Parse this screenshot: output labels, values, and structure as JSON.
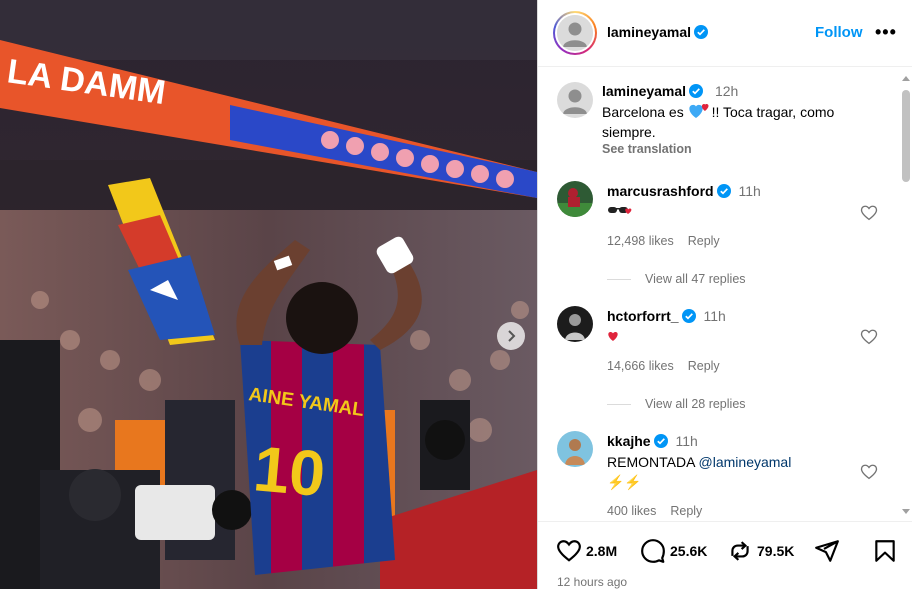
{
  "post": {
    "author": "lamineyamal",
    "follow_label": "Follow",
    "more_label": "•••",
    "caption_time": "12h",
    "caption_line1": "Barcelona es ",
    "caption_line1_end": "!! Toca tragar, como",
    "caption_line2": "siempre.",
    "see_translation": "See translation"
  },
  "photo": {
    "banner_text": "LA DAMM",
    "jersey_name": "AINE YAMAL",
    "jersey_number": "10"
  },
  "comments": [
    {
      "user": "marcusrashford",
      "time": "11h",
      "text": "",
      "likes": "12,498 likes",
      "reply": "Reply",
      "view_replies": "View all 47 replies"
    },
    {
      "user": "hctorforrt_",
      "time": "11h",
      "text": "",
      "likes": "14,666 likes",
      "reply": "Reply",
      "view_replies": "View all 28 replies"
    },
    {
      "user": "kkajhe",
      "time": "11h",
      "text": "REMONTADA ",
      "mention": "@lamineyamal",
      "text2": "⚡⚡",
      "likes": "400 likes",
      "reply": "Reply"
    }
  ],
  "actions": {
    "likes_count": "2.8M",
    "comments_count": "25.6K",
    "reposts_count": "79.5K"
  },
  "posted_ago": "12 hours ago",
  "colors": {
    "accent_blue": "#0095f6",
    "verified_blue": "#0095f6",
    "muted_text": "#737373",
    "barca_blue": "#1b3e8f",
    "barca_red": "#a50044"
  }
}
